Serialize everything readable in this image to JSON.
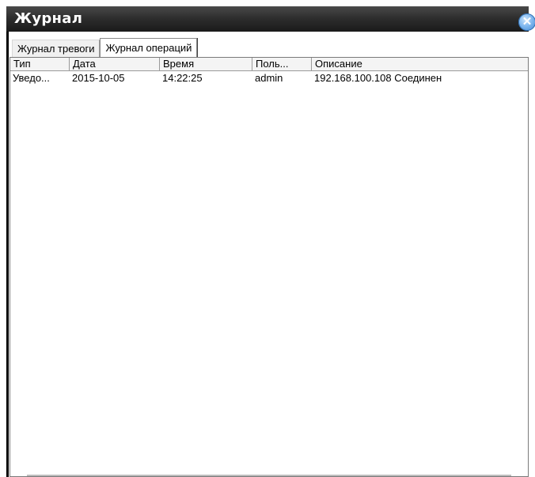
{
  "window": {
    "title": "Журнал",
    "close_icon": "close-icon",
    "accent": "#3f86d2"
  },
  "tabs": [
    {
      "label": "Журнал тревоги",
      "active": false
    },
    {
      "label": "Журнал операций",
      "active": true
    }
  ],
  "table": {
    "columns": [
      "Тип",
      "Дата",
      "Время",
      "Поль...",
      "Описание"
    ],
    "rows": [
      {
        "type": "Уведо...",
        "date": "2015-10-05",
        "time": "14:22:25",
        "user": "admin",
        "description": "192.168.100.108  Соединен"
      }
    ]
  }
}
